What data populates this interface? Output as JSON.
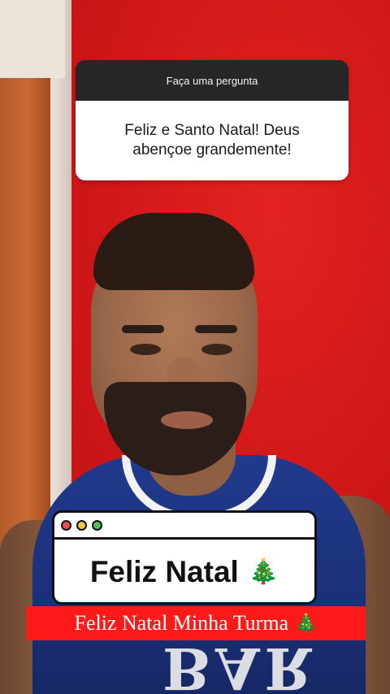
{
  "question_sticker": {
    "header": "Faça uma pergunta",
    "answer": "Feliz e Santo Natal! Deus abençoe grandemente!"
  },
  "window_sticker": {
    "title": "Feliz Natal",
    "title_emoji": "🎄",
    "buttons": [
      "close",
      "minimize",
      "maximize"
    ]
  },
  "caption": {
    "text": "Feliz Natal Minha Turma",
    "emoji": "🎄"
  },
  "shirt_text": "BAR",
  "colors": {
    "background_wall": "#c8161a",
    "caption_bg": "#ff1a1a",
    "question_header_bg": "#262626",
    "dot_red": "#ee4d4d",
    "dot_yellow": "#f3c544",
    "dot_green": "#49c25a"
  }
}
